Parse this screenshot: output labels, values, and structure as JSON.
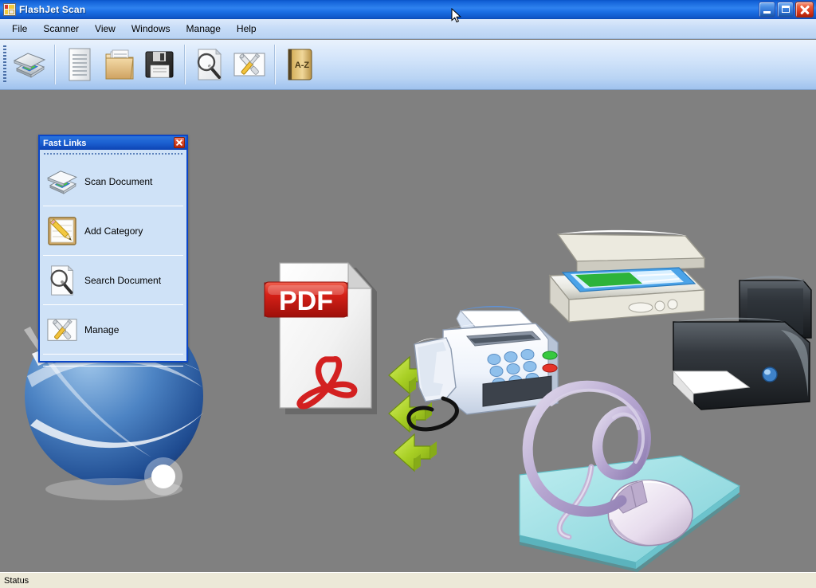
{
  "window": {
    "title": "FlashJet Scan",
    "app_icon": "app-icon",
    "buttons": {
      "minimize": "minimize-button",
      "maximize": "maximize-button",
      "close": "close-button"
    }
  },
  "menu": {
    "items": [
      {
        "label": "File"
      },
      {
        "label": "Scanner"
      },
      {
        "label": "View"
      },
      {
        "label": "Windows"
      },
      {
        "label": "Manage"
      },
      {
        "label": "Help"
      }
    ]
  },
  "toolbar": {
    "buttons": [
      {
        "icon": "scanner-icon",
        "tooltip": "Scan Document"
      },
      {
        "icon": "document-icon",
        "tooltip": "Document"
      },
      {
        "icon": "folder-documents-icon",
        "tooltip": "Categories"
      },
      {
        "icon": "floppy-save-icon",
        "tooltip": "Save"
      },
      {
        "icon": "magnifier-search-icon",
        "tooltip": "Search Document"
      },
      {
        "icon": "tools-manage-icon",
        "tooltip": "Manage"
      },
      {
        "icon": "az-book-icon",
        "tooltip": "Index"
      }
    ]
  },
  "fast_links": {
    "title": "Fast Links",
    "close_icon": "close-icon",
    "items": [
      {
        "label": "Scan Document",
        "icon": "scanner-icon"
      },
      {
        "label": "Add Category",
        "icon": "pencil-note-icon"
      },
      {
        "label": "Search Document",
        "icon": "magnifier-search-icon"
      },
      {
        "label": "Manage",
        "icon": "tools-manage-icon"
      }
    ]
  },
  "workspace": {
    "background_color": "#808080",
    "illustration": {
      "name": "document-workflow-illustration",
      "elements": [
        {
          "name": "globe-graphic",
          "label": ""
        },
        {
          "name": "pdf-document-graphic",
          "label": "PDF"
        },
        {
          "name": "green-arrows-graphic",
          "label": ""
        },
        {
          "name": "fax-machine-graphic",
          "label": ""
        },
        {
          "name": "flatbed-scanner-graphic",
          "label": ""
        },
        {
          "name": "inkjet-printer-graphic",
          "label": ""
        },
        {
          "name": "at-symbol-graphic",
          "label": "@"
        },
        {
          "name": "mousepad-mouse-graphic",
          "label": ""
        }
      ]
    }
  },
  "statusbar": {
    "text": "Status"
  },
  "colors": {
    "title_blue": "#1362d8",
    "toolbar_blue": "#d2e4fa",
    "workspace_gray": "#808080",
    "panel_blue": "#cfe2f7",
    "panel_border": "#0a46c8",
    "status_beige": "#ece9d8",
    "pdf_red": "#d32020",
    "arrow_green": "#9fcb25",
    "at_purple": "#b2a3cb",
    "mousepad_teal": "#9edfe3"
  }
}
